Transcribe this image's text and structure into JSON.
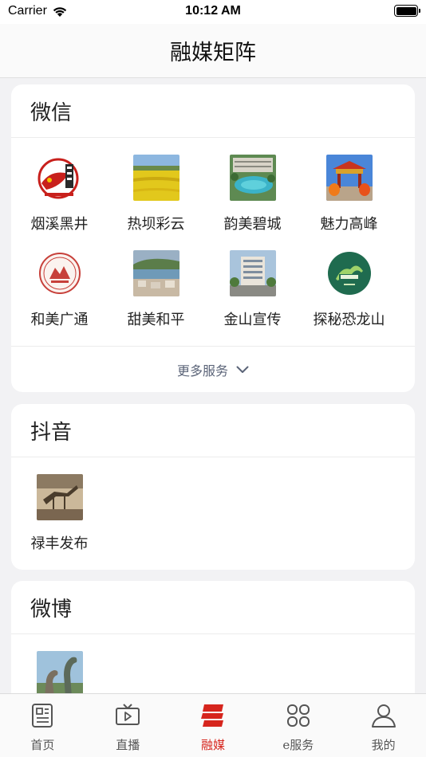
{
  "status_bar": {
    "carrier": "Carrier",
    "time": "10:12 AM"
  },
  "nav": {
    "title": "融媒矩阵"
  },
  "sections": {
    "wechat": {
      "title": "微信",
      "items": [
        {
          "label": "烟溪黑井",
          "icon": "red-seal-logo"
        },
        {
          "label": "热坝彩云",
          "icon": "rapeseed-field-photo"
        },
        {
          "label": "韵美碧城",
          "icon": "pool-resort-photo"
        },
        {
          "label": "魅力高峰",
          "icon": "festival-gate-photo"
        },
        {
          "label": "和美广通",
          "icon": "round-emblem-logo"
        },
        {
          "label": "甜美和平",
          "icon": "lakeside-town-photo"
        },
        {
          "label": "金山宣传",
          "icon": "office-building-photo"
        },
        {
          "label": "探秘恐龙山",
          "icon": "dinosaur-mountain-logo"
        }
      ],
      "more_label": "更多服务"
    },
    "douyin": {
      "title": "抖音",
      "items": [
        {
          "label": "禄丰发布",
          "icon": "dinosaur-skeleton-photo"
        }
      ]
    },
    "weibo": {
      "title": "微博",
      "items": [
        {
          "label": "",
          "icon": "dinosaur-statue-photo"
        }
      ]
    }
  },
  "tabs": [
    {
      "label": "首页",
      "icon": "news-icon",
      "active": false
    },
    {
      "label": "直播",
      "icon": "tv-icon",
      "active": false
    },
    {
      "label": "融媒",
      "icon": "media-logo-icon",
      "active": true
    },
    {
      "label": "e服务",
      "icon": "services-grid-icon",
      "active": false
    },
    {
      "label": "我的",
      "icon": "person-icon",
      "active": false
    }
  ],
  "colors": {
    "accent": "#d6251d",
    "text": "#222222",
    "more_text": "#5b6478",
    "background": "#f2f2f4"
  }
}
